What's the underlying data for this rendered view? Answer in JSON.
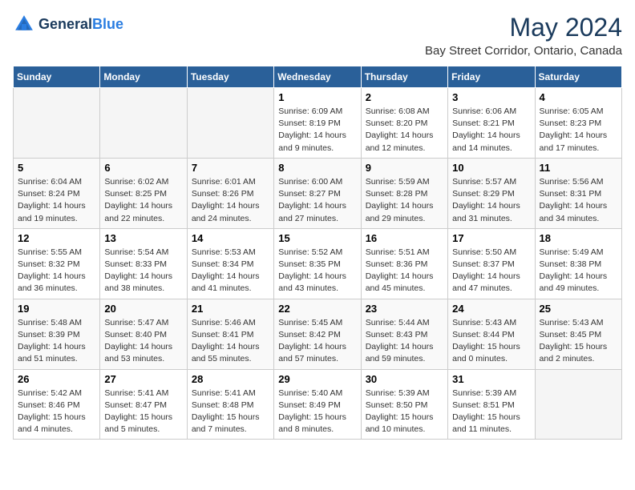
{
  "header": {
    "logo": {
      "general": "General",
      "blue": "Blue"
    },
    "title": "May 2024",
    "location": "Bay Street Corridor, Ontario, Canada"
  },
  "weekdays": [
    "Sunday",
    "Monday",
    "Tuesday",
    "Wednesday",
    "Thursday",
    "Friday",
    "Saturday"
  ],
  "weeks": [
    [
      {
        "day": "",
        "info": ""
      },
      {
        "day": "",
        "info": ""
      },
      {
        "day": "",
        "info": ""
      },
      {
        "day": "1",
        "info": "Sunrise: 6:09 AM\nSunset: 8:19 PM\nDaylight: 14 hours\nand 9 minutes."
      },
      {
        "day": "2",
        "info": "Sunrise: 6:08 AM\nSunset: 8:20 PM\nDaylight: 14 hours\nand 12 minutes."
      },
      {
        "day": "3",
        "info": "Sunrise: 6:06 AM\nSunset: 8:21 PM\nDaylight: 14 hours\nand 14 minutes."
      },
      {
        "day": "4",
        "info": "Sunrise: 6:05 AM\nSunset: 8:23 PM\nDaylight: 14 hours\nand 17 minutes."
      }
    ],
    [
      {
        "day": "5",
        "info": "Sunrise: 6:04 AM\nSunset: 8:24 PM\nDaylight: 14 hours\nand 19 minutes."
      },
      {
        "day": "6",
        "info": "Sunrise: 6:02 AM\nSunset: 8:25 PM\nDaylight: 14 hours\nand 22 minutes."
      },
      {
        "day": "7",
        "info": "Sunrise: 6:01 AM\nSunset: 8:26 PM\nDaylight: 14 hours\nand 24 minutes."
      },
      {
        "day": "8",
        "info": "Sunrise: 6:00 AM\nSunset: 8:27 PM\nDaylight: 14 hours\nand 27 minutes."
      },
      {
        "day": "9",
        "info": "Sunrise: 5:59 AM\nSunset: 8:28 PM\nDaylight: 14 hours\nand 29 minutes."
      },
      {
        "day": "10",
        "info": "Sunrise: 5:57 AM\nSunset: 8:29 PM\nDaylight: 14 hours\nand 31 minutes."
      },
      {
        "day": "11",
        "info": "Sunrise: 5:56 AM\nSunset: 8:31 PM\nDaylight: 14 hours\nand 34 minutes."
      }
    ],
    [
      {
        "day": "12",
        "info": "Sunrise: 5:55 AM\nSunset: 8:32 PM\nDaylight: 14 hours\nand 36 minutes."
      },
      {
        "day": "13",
        "info": "Sunrise: 5:54 AM\nSunset: 8:33 PM\nDaylight: 14 hours\nand 38 minutes."
      },
      {
        "day": "14",
        "info": "Sunrise: 5:53 AM\nSunset: 8:34 PM\nDaylight: 14 hours\nand 41 minutes."
      },
      {
        "day": "15",
        "info": "Sunrise: 5:52 AM\nSunset: 8:35 PM\nDaylight: 14 hours\nand 43 minutes."
      },
      {
        "day": "16",
        "info": "Sunrise: 5:51 AM\nSunset: 8:36 PM\nDaylight: 14 hours\nand 45 minutes."
      },
      {
        "day": "17",
        "info": "Sunrise: 5:50 AM\nSunset: 8:37 PM\nDaylight: 14 hours\nand 47 minutes."
      },
      {
        "day": "18",
        "info": "Sunrise: 5:49 AM\nSunset: 8:38 PM\nDaylight: 14 hours\nand 49 minutes."
      }
    ],
    [
      {
        "day": "19",
        "info": "Sunrise: 5:48 AM\nSunset: 8:39 PM\nDaylight: 14 hours\nand 51 minutes."
      },
      {
        "day": "20",
        "info": "Sunrise: 5:47 AM\nSunset: 8:40 PM\nDaylight: 14 hours\nand 53 minutes."
      },
      {
        "day": "21",
        "info": "Sunrise: 5:46 AM\nSunset: 8:41 PM\nDaylight: 14 hours\nand 55 minutes."
      },
      {
        "day": "22",
        "info": "Sunrise: 5:45 AM\nSunset: 8:42 PM\nDaylight: 14 hours\nand 57 minutes."
      },
      {
        "day": "23",
        "info": "Sunrise: 5:44 AM\nSunset: 8:43 PM\nDaylight: 14 hours\nand 59 minutes."
      },
      {
        "day": "24",
        "info": "Sunrise: 5:43 AM\nSunset: 8:44 PM\nDaylight: 15 hours\nand 0 minutes."
      },
      {
        "day": "25",
        "info": "Sunrise: 5:43 AM\nSunset: 8:45 PM\nDaylight: 15 hours\nand 2 minutes."
      }
    ],
    [
      {
        "day": "26",
        "info": "Sunrise: 5:42 AM\nSunset: 8:46 PM\nDaylight: 15 hours\nand 4 minutes."
      },
      {
        "day": "27",
        "info": "Sunrise: 5:41 AM\nSunset: 8:47 PM\nDaylight: 15 hours\nand 5 minutes."
      },
      {
        "day": "28",
        "info": "Sunrise: 5:41 AM\nSunset: 8:48 PM\nDaylight: 15 hours\nand 7 minutes."
      },
      {
        "day": "29",
        "info": "Sunrise: 5:40 AM\nSunset: 8:49 PM\nDaylight: 15 hours\nand 8 minutes."
      },
      {
        "day": "30",
        "info": "Sunrise: 5:39 AM\nSunset: 8:50 PM\nDaylight: 15 hours\nand 10 minutes."
      },
      {
        "day": "31",
        "info": "Sunrise: 5:39 AM\nSunset: 8:51 PM\nDaylight: 15 hours\nand 11 minutes."
      },
      {
        "day": "",
        "info": ""
      }
    ]
  ]
}
